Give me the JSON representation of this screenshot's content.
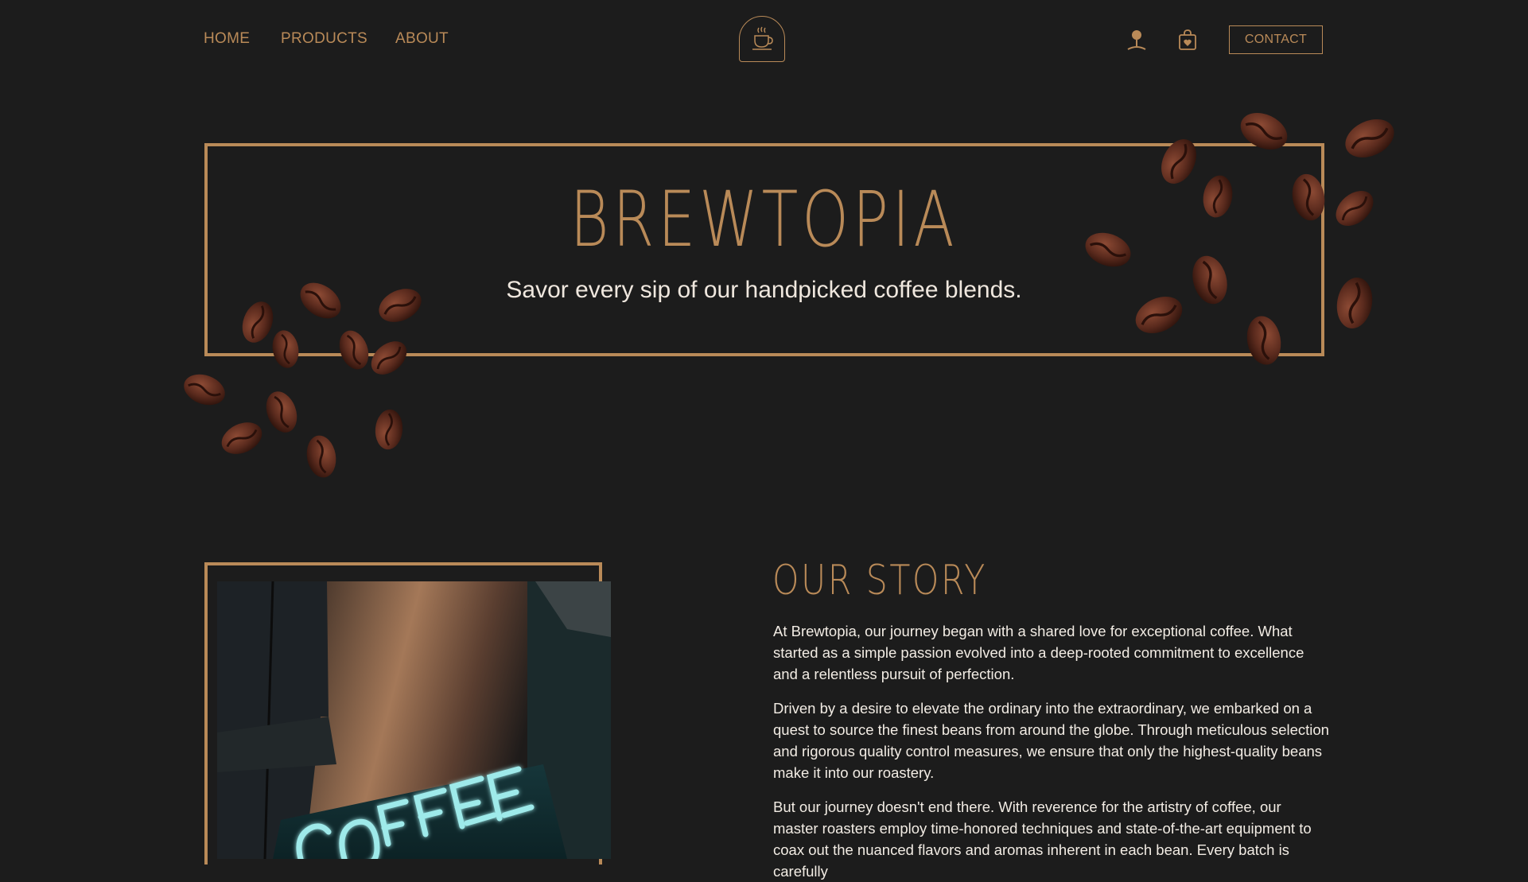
{
  "nav": {
    "links": [
      "HOME",
      "PRODUCTS",
      "ABOUT"
    ],
    "contact_label": "CONTACT"
  },
  "icons": [
    "coffee-cup-logo-icon",
    "user-icon",
    "shopping-bag-icon",
    "coffee-bean-icon"
  ],
  "hero": {
    "title": "BREWTOPIA",
    "subtitle": "Savor every sip of our handpicked coffee blends."
  },
  "story": {
    "title": "OUR STORY",
    "paragraphs": [
      "At Brewtopia, our journey began with a shared love for exceptional coffee. What started as a simple passion evolved into a deep-rooted commitment to excellence and a relentless pursuit of perfection.",
      "Driven by a desire to elevate the ordinary into the extraordinary, we embarked on a quest to source the finest beans from around the globe. Through meticulous selection and rigorous quality control measures, we ensure that only the highest-quality beans make it into our roastery.",
      "But our journey doesn't end there. With reverence for the artistry of coffee, our master roasters employ time-honored techniques and state-of-the-art equipment to coax out the nuanced flavors and aromas inherent in each bean. Every batch is carefully"
    ],
    "photo_sign_text": "COFFEE"
  },
  "colors": {
    "background": "#1c1c1c",
    "accent": "#b98a58",
    "text": "#f2ece4",
    "bean": "#6a3324",
    "neon": "#9eeaea"
  }
}
